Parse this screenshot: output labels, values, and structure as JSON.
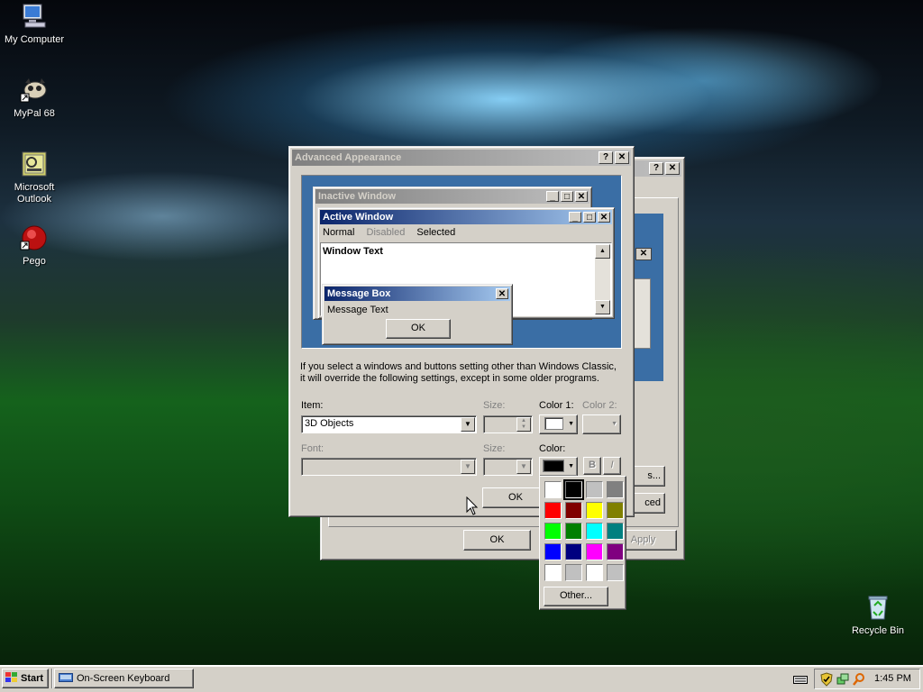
{
  "desktop": {
    "icons": [
      {
        "label": "My Computer"
      },
      {
        "label": "MyPal 68"
      },
      {
        "label": "Microsoft Outlook"
      },
      {
        "label": "Pego"
      },
      {
        "label": "Recycle Bin"
      }
    ]
  },
  "back_dialog": {
    "ok_label": "OK",
    "apply_label": "Apply",
    "effects_label": "s...",
    "advanced_label": "ced",
    "help_glyph": "?",
    "close_glyph": "✕"
  },
  "advanced_appearance": {
    "title": "Advanced Appearance",
    "help_glyph": "?",
    "close_glyph": "✕",
    "preview": {
      "inactive_title": "Inactive Window",
      "active_title": "Active Window",
      "menu": [
        "Normal",
        "Disabled",
        "Selected"
      ],
      "window_text": "Window Text",
      "message_box_title": "Message Box",
      "message_text": "Message Text",
      "message_ok": "OK"
    },
    "info_line1": "If you select a windows and buttons setting other than Windows Classic,",
    "info_line2": "it will override the following settings, except in some older programs.",
    "item_label": "Item:",
    "item_value": "3D Objects",
    "size_label": "Size:",
    "color1_label": "Color 1:",
    "color2_label": "Color 2:",
    "font_label": "Font:",
    "font_size_label": "Size:",
    "font_color_label": "Color:",
    "bold_glyph": "B",
    "italic_glyph": "I",
    "ok_label": "OK"
  },
  "color_picker": {
    "colors": [
      "#ffffff",
      "#000000",
      "#c0c0c0",
      "#808080",
      "#ff0000",
      "#800000",
      "#ffff00",
      "#808000",
      "#00ff00",
      "#008000",
      "#00ffff",
      "#008080",
      "#0000ff",
      "#000080",
      "#ff00ff",
      "#800080",
      "#ffffff",
      "#c0c0c0",
      "#ffffff",
      "#c0c0c0"
    ],
    "selected_index": 1,
    "other_label": "Other..."
  },
  "taskbar": {
    "start_label": "Start",
    "task_label": "On-Screen Keyboard",
    "clock": "1:45 PM"
  }
}
